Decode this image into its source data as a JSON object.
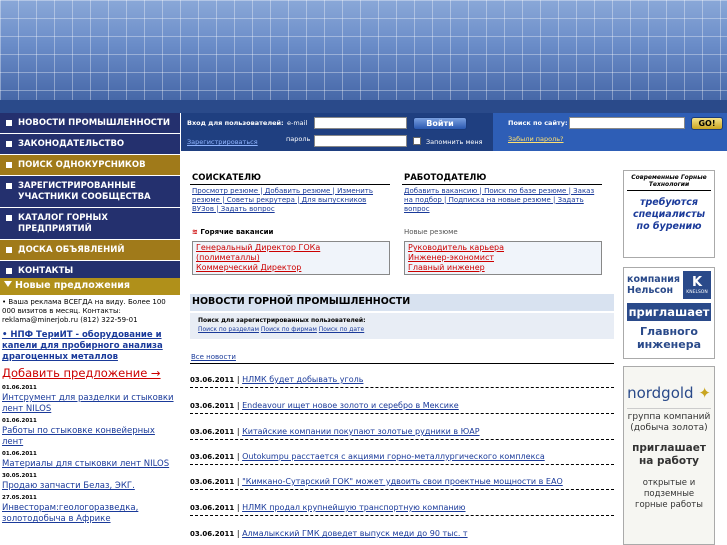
{
  "nav": [
    {
      "label": "НОВОСТИ ПРОМЫШЛЕННОСТИ",
      "style": "dark"
    },
    {
      "label": "ЗАКОНОДАТЕЛЬСТВО",
      "style": "dark"
    },
    {
      "label": "ПОИСК ОДНОКУРСНИКОВ",
      "style": "gold"
    },
    {
      "label": "ЗАРЕГИСТРИРОВАННЫЕ УЧАСТНИКИ СООБЩЕСТВА",
      "style": "dark"
    },
    {
      "label": "КАТАЛОГ ГОРНЫХ ПРЕДПРИЯТИЙ",
      "style": "dark"
    },
    {
      "label": "ДОСКА ОБЪЯВЛЕНИЙ",
      "style": "gold"
    },
    {
      "label": "КОНТАКТЫ",
      "style": "dark"
    }
  ],
  "offers": {
    "heading": "Новые предложения",
    "ad_text": "• Ваша реклама ВСЕГДА на виду. Более 100 000 визитов в месяц. Контакты: reklama@minerjob.ru (812) 322-59-01",
    "featured": "• НПФ ТериИТ - оборудование и капели для пробирного анализа драгоценных металлов",
    "add_link": "Добавить предложение →",
    "items": [
      {
        "date": "01.06.2011",
        "text": "Интсрумент для разделки и стыковки лент NILOS"
      },
      {
        "date": "01.06.2011",
        "text": "Работы по стыковке конвейерных лент"
      },
      {
        "date": "01.06.2011",
        "text": "Материалы для стыковки лент NILOS"
      },
      {
        "date": "30.05.2011",
        "text": "Продаю запчасти Белаз, ЭКГ."
      },
      {
        "date": "27.05.2011",
        "text": "Инвесторам:геологоразведка, золотодобыча в Африке"
      }
    ]
  },
  "login": {
    "prompt": "Вход для пользователей:",
    "email_label": "e-mail",
    "password_label": "пароль",
    "enter_label": "Войти",
    "register_link": "Зарегистрироваться",
    "remember_label": "Запомнить меня",
    "search_label": "Поиск по сайту:",
    "go_label": "GO!",
    "forgot_link": "Забыли пароль?"
  },
  "seekers": {
    "title": "СОИСКАТЕЛЮ",
    "links": "Просмотр резюме | Добавить резюме | Изменить резюме | Советы рекрутера | Для выпускников ВУЗов | Задать вопрос",
    "hot_label": "Горячие вакансии",
    "hot": [
      "Генеральный Директор ГОКа (полиметаллы)",
      "Коммерческий Директор"
    ]
  },
  "employer": {
    "title": "РАБОТОДАТЕЛЮ",
    "links": "Добавить вакансию | Поиск по базе резюме | Заказ на подбор | Подписка на новые резюме | Задать вопрос",
    "new_label": "Новые резюме",
    "new": [
      "Руководитель карьера",
      "Инженер-экономист",
      "Главный инженер"
    ]
  },
  "news": {
    "title": "НОВОСТИ ГОРНОЙ ПРОМЫШЛЕННОСТИ",
    "sub_label": "Поиск для зарегистрированных пользователей:",
    "sub_links": [
      "Поиск по разделам",
      "Поиск по фирмам",
      "Поиск по дате"
    ],
    "all_link": "Все новости",
    "items": [
      {
        "date": "03.06.2011",
        "text": "НЛМК будет добывать уголь"
      },
      {
        "date": "03.06.2011",
        "text": "Endeavour ищет новое золото и серебро в Мексике"
      },
      {
        "date": "03.06.2011",
        "text": "Китайские компании покупают золотые рудники в ЮАР"
      },
      {
        "date": "03.06.2011",
        "text": "Outokumpu расстается с акциями горно-металлургического комплекса"
      },
      {
        "date": "03.06.2011",
        "text": "\"Кимкано-Сутарский ГОК\" может удвоить свои проектные мощности в ЕАО"
      },
      {
        "date": "03.06.2011",
        "text": "НЛМК продал крупнейшую транспортную компанию"
      },
      {
        "date": "03.06.2011",
        "text": "Алмалыкский ГМК доведет выпуск меди до 90 тыс. т"
      }
    ]
  },
  "ads": {
    "ad1_logo": "Современные Горные Технологии",
    "ad1_text": "требуются специалисты по бурению",
    "ad2_company": "компания Нельсон",
    "ad2_brand": "KNELSON",
    "ad2_invite": "приглашает",
    "ad2_role": "Главного инженера",
    "ad3_logo": "nordgold",
    "ad3_group": "группа компаний (добыча золота)",
    "ad3_invite": "приглашает на работу",
    "ad3_text": "открытые и подземные горные работы"
  }
}
